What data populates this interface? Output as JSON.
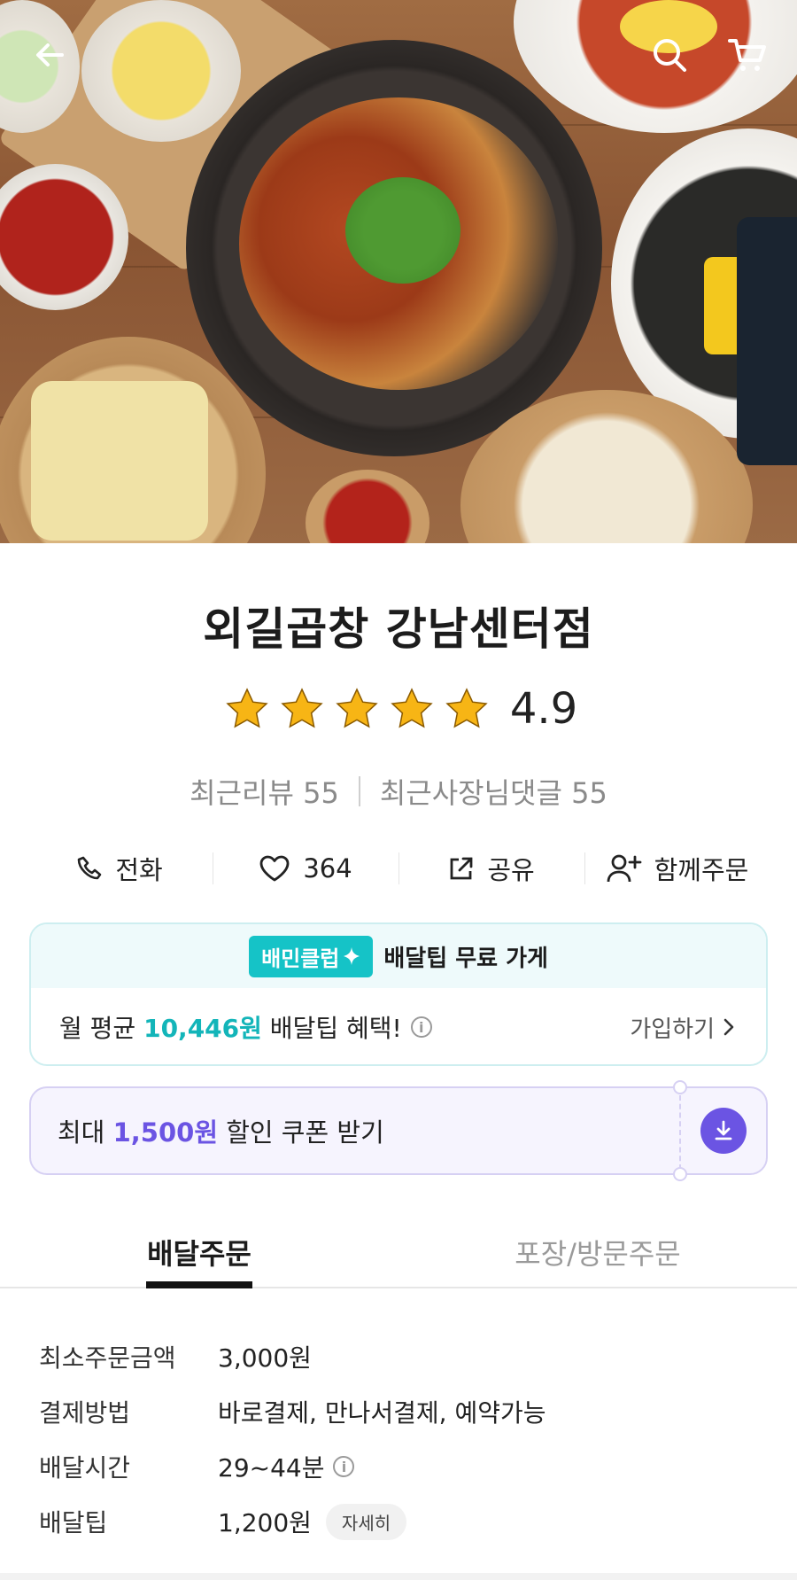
{
  "store": {
    "name": "외길곱창 강남센터점",
    "rating": "4.9",
    "stars_filled": 5,
    "recent_reviews": "최근리뷰 55",
    "owner_replies": "최근사장님댓글 55"
  },
  "actions": {
    "call": "전화",
    "likes": "364",
    "share": "공유",
    "group_order": "함께주문"
  },
  "club": {
    "badge": "배민클럽",
    "headline": "배달팁 무료 가게",
    "prefix": "월 평균 ",
    "amount": "10,446원",
    "suffix": " 배달팁 혜택!",
    "info": "i",
    "join": "가입하기"
  },
  "coupon": {
    "prefix": "최대 ",
    "amount": "1,500원",
    "suffix": " 할인 쿠폰 받기"
  },
  "tabs": [
    {
      "label": "배달주문",
      "active": true
    },
    {
      "label": "포장/방문주문",
      "active": false
    }
  ],
  "delivery_info": {
    "min_order_label": "최소주문금액",
    "min_order_value": "3,000원",
    "payment_label": "결제방법",
    "payment_value": "바로결제, 만나서결제, 예약가능",
    "time_label": "배달시간",
    "time_value": "29~44분",
    "tip_label": "배달팁",
    "tip_value": "1,200원",
    "detail_chip": "자세히",
    "info": "i"
  },
  "colors": {
    "teal": "#13b5b9",
    "purple": "#6b54e3",
    "star": "#f7b515"
  },
  "icons": [
    "back-arrow-icon",
    "search-icon",
    "cart-icon",
    "phone-icon",
    "heart-icon",
    "share-icon",
    "add-person-icon",
    "download-icon",
    "chevron-right-icon",
    "info-icon"
  ]
}
